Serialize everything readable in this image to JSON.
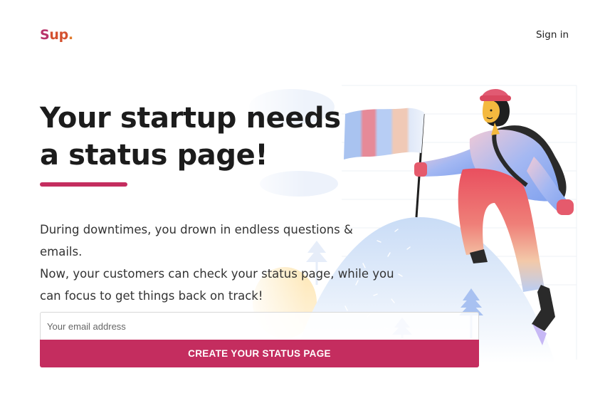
{
  "header": {
    "logo": {
      "part1": "S",
      "part2": "up",
      "part3": "."
    },
    "signin_label": "Sign in"
  },
  "hero": {
    "headline_line1": "Your startup needs",
    "headline_line2": "a status page!",
    "description_line1": "During downtimes, you drown in endless questions & emails.",
    "description_line2": "Now, your customers can check your status page, while you",
    "description_line3": "can focus to get things back on track!"
  },
  "signup": {
    "email_placeholder": "Your email address",
    "email_value": "",
    "cta_label": "CREATE YOUR STATUS PAGE"
  },
  "colors": {
    "accent": "#c42d5f",
    "logo_s": "#b8336a",
    "logo_up": "#d4512f",
    "logo_dot": "#e07a2c"
  },
  "illustration": {
    "icon": "hiker-with-flag-on-mountain-illustration"
  }
}
